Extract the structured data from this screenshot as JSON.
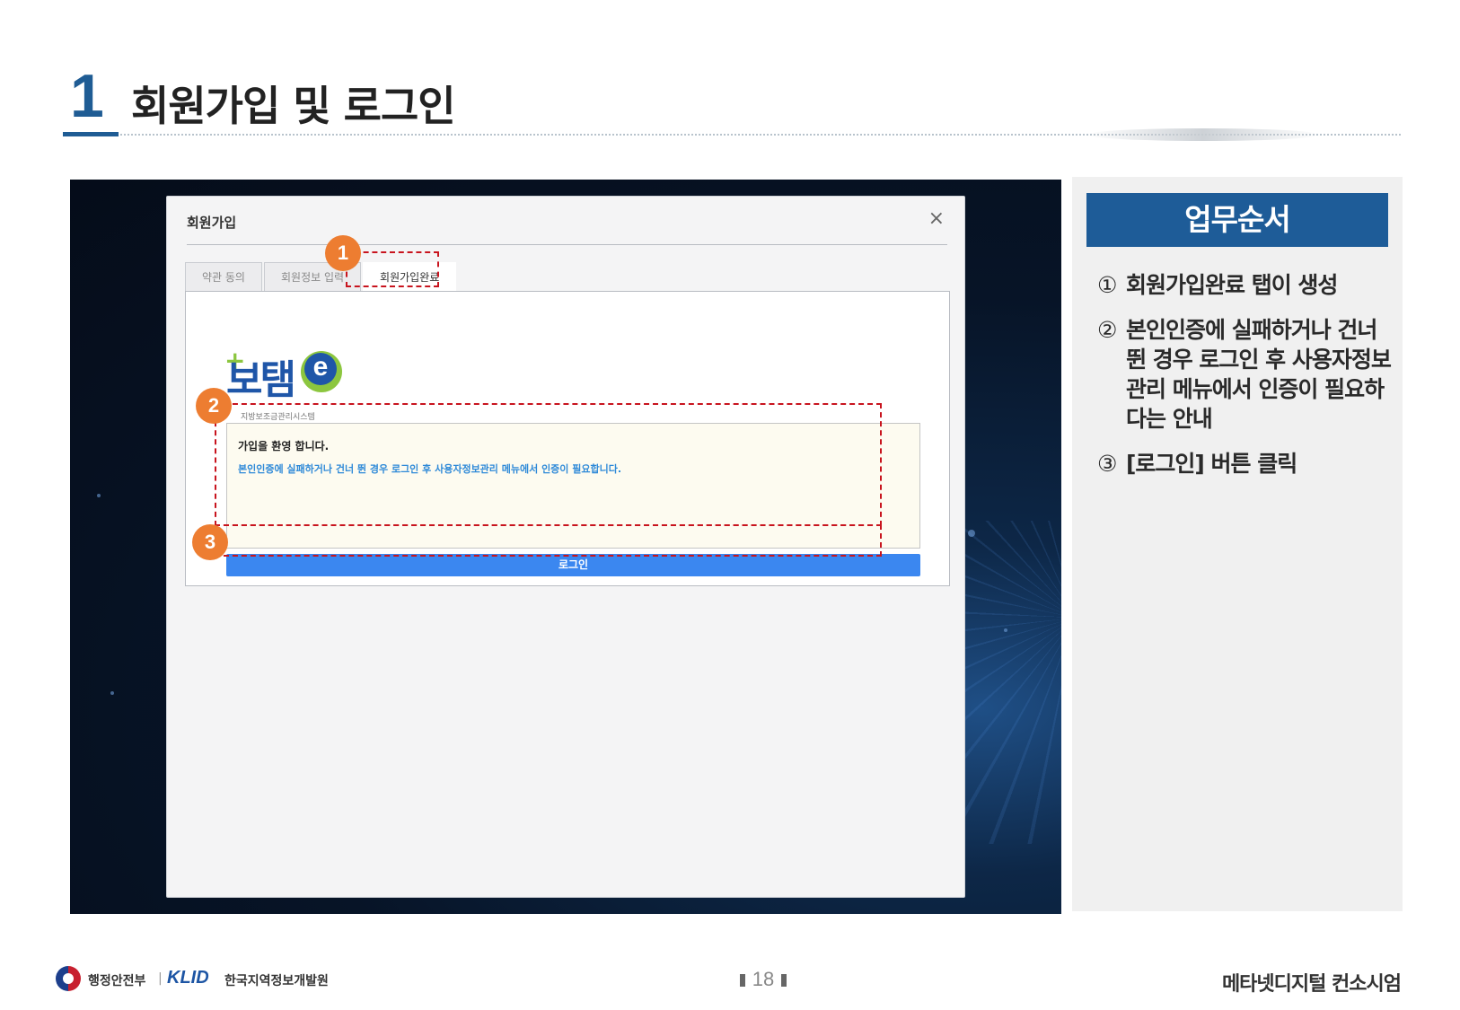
{
  "slide": {
    "section_number": "1",
    "section_title": "회원가입 및 로그인"
  },
  "dialog": {
    "title": "회원가입",
    "close_icon": "close-icon",
    "tabs": [
      {
        "label": "약관 동의",
        "active": false
      },
      {
        "label": "회원정보 입력",
        "active": false
      },
      {
        "label": "회원가입완료",
        "active": true
      }
    ],
    "logo": {
      "brand": "보탬e",
      "subtitle": "지방보조금관리시스템"
    },
    "message": {
      "welcome": "가입을 환영 합니다.",
      "notice": "본인인증에 실패하거나 건너 뛴 경우 로그인 후 사용자정보관리 메뉴에서 인증이 필요합니다."
    },
    "login_button": "로그인"
  },
  "markers": [
    "1",
    "2",
    "3"
  ],
  "side_panel": {
    "title": "업무순서",
    "steps": [
      {
        "num": "①",
        "text": "회원가입완료 탭이 생성"
      },
      {
        "num": "②",
        "text": "본인인증에 실패하거나 건너 뛴 경우 로그인 후 사용자정보관리 메뉴에서 인증이 필요하다는 안내"
      },
      {
        "num": "③",
        "text": "[로그인] 버튼 클릭"
      }
    ]
  },
  "footer": {
    "org_name": "행정안전부",
    "separator": "|",
    "klid_logo": "KLID",
    "klid_name": "한국지역정보개발원",
    "page_number": "18",
    "project_name": "메타넷디지털 컨소시엄"
  },
  "colors": {
    "primary_blue": "#1e5c98",
    "marker_orange": "#ed7d31",
    "callout_red": "#c8141e",
    "button_blue": "#3b87f0",
    "notice_blue": "#2f8ad8"
  }
}
